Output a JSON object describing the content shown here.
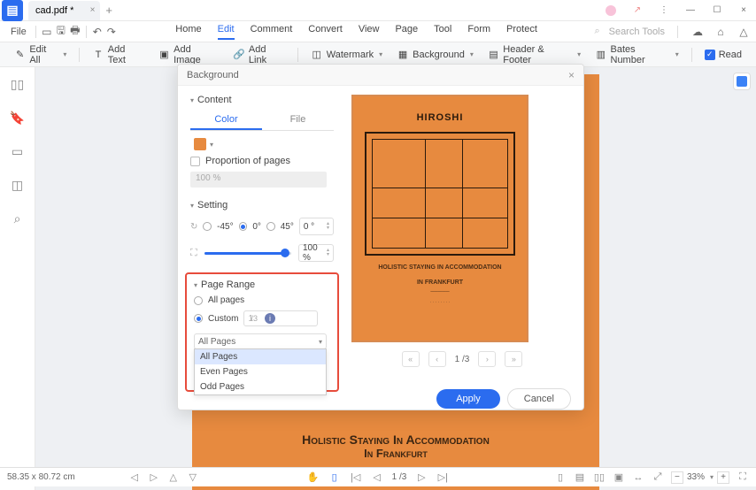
{
  "titlebar": {
    "tab_name": "cad.pdf *"
  },
  "menubar": {
    "file": "File",
    "items": [
      "Home",
      "Edit",
      "Comment",
      "Convert",
      "View",
      "Page",
      "Tool",
      "Form",
      "Protect"
    ],
    "active_index": 1,
    "search_placeholder": "Search Tools"
  },
  "toolbar": {
    "edit_all": "Edit All",
    "add_text": "Add Text",
    "add_image": "Add Image",
    "add_link": "Add Link",
    "watermark": "Watermark",
    "background": "Background",
    "header_footer": "Header & Footer",
    "bates_number": "Bates Number",
    "read": "Read"
  },
  "dialog": {
    "title": "Background",
    "content_label": "Content",
    "tabs": {
      "color": "Color",
      "file": "File",
      "active": 0
    },
    "proportion_label": "Proportion of pages",
    "proportion_value": "100 %",
    "setting_label": "Setting",
    "angles": {
      "neg45": "-45°",
      "zero": "0°",
      "pos45": "45°",
      "input": "0 °",
      "selected": 1
    },
    "opacity": {
      "value": "100 %"
    },
    "page_range_label": "Page Range",
    "pr_all": "All pages",
    "pr_custom": "Custom",
    "pr_custom_value": "1",
    "pr_total": "/3",
    "pr_select_value": "All Pages",
    "pr_options": [
      "All Pages",
      "Even Pages",
      "Odd Pages"
    ],
    "apply": "Apply",
    "cancel": "Cancel"
  },
  "preview": {
    "title": "HIROSHI",
    "subtitle1": "Holistic Staying In Accommodation",
    "subtitle2": "In Frankfurt",
    "pager": {
      "first": "«",
      "prev": "‹",
      "label": "1 /3",
      "next": "›",
      "last": "»"
    }
  },
  "page": {
    "line1": "Holistic Staying In Accommodation",
    "line2": "In Frankfurt"
  },
  "statusbar": {
    "coords": "58.35 x 80.72 cm",
    "page": "1 /3",
    "zoom": "33%"
  }
}
